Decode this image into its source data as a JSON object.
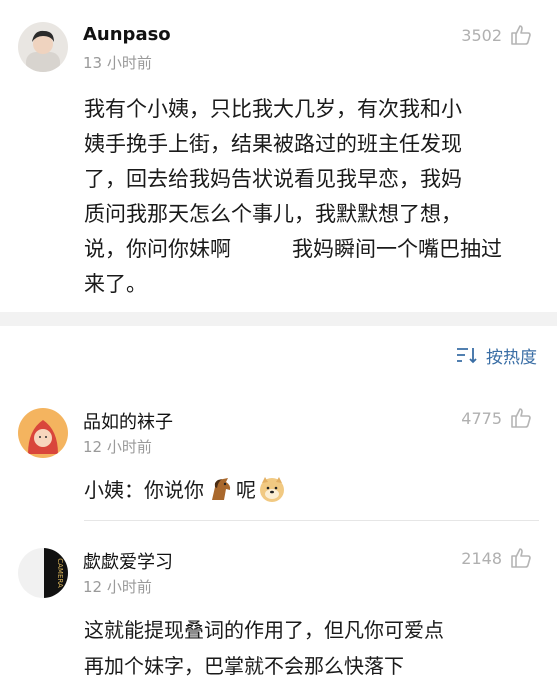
{
  "post": {
    "username": "Aunpaso",
    "time": "13 小时前",
    "likes": "3502",
    "text_lines": [
      "我有个小姨，只比我大几岁，有次我和小",
      "姨手挽手上街，结果被路过的班主任发现",
      "了，回去给我妈告状说看见我早恋，我妈",
      "质问我那天怎么个事儿，我默默想了想，",
      "说，你问你妹啊",
      "我妈瞬间一个嘴巴抽过",
      "来了。"
    ]
  },
  "sort": {
    "label": "按热度",
    "icon": "sort-icon"
  },
  "comments": [
    {
      "username": "品如的袜子",
      "time": "12 小时前",
      "likes": "4775",
      "text_prefix": "小姨：你说你",
      "text_middle": "呢",
      "emojis": [
        "horse-emoji",
        "doge-emoji"
      ]
    },
    {
      "username": "歔歔爱学习",
      "time": "12 小时前",
      "likes": "2148",
      "text_lines": [
        "这就能提现叠词的作用了，但凡你可爱点",
        "再加个妹字，巴掌就不会那么快落下"
      ]
    }
  ],
  "colors": {
    "link": "#3a6ea5",
    "muted": "#9a9a9a",
    "band": "#f2f2f2"
  }
}
